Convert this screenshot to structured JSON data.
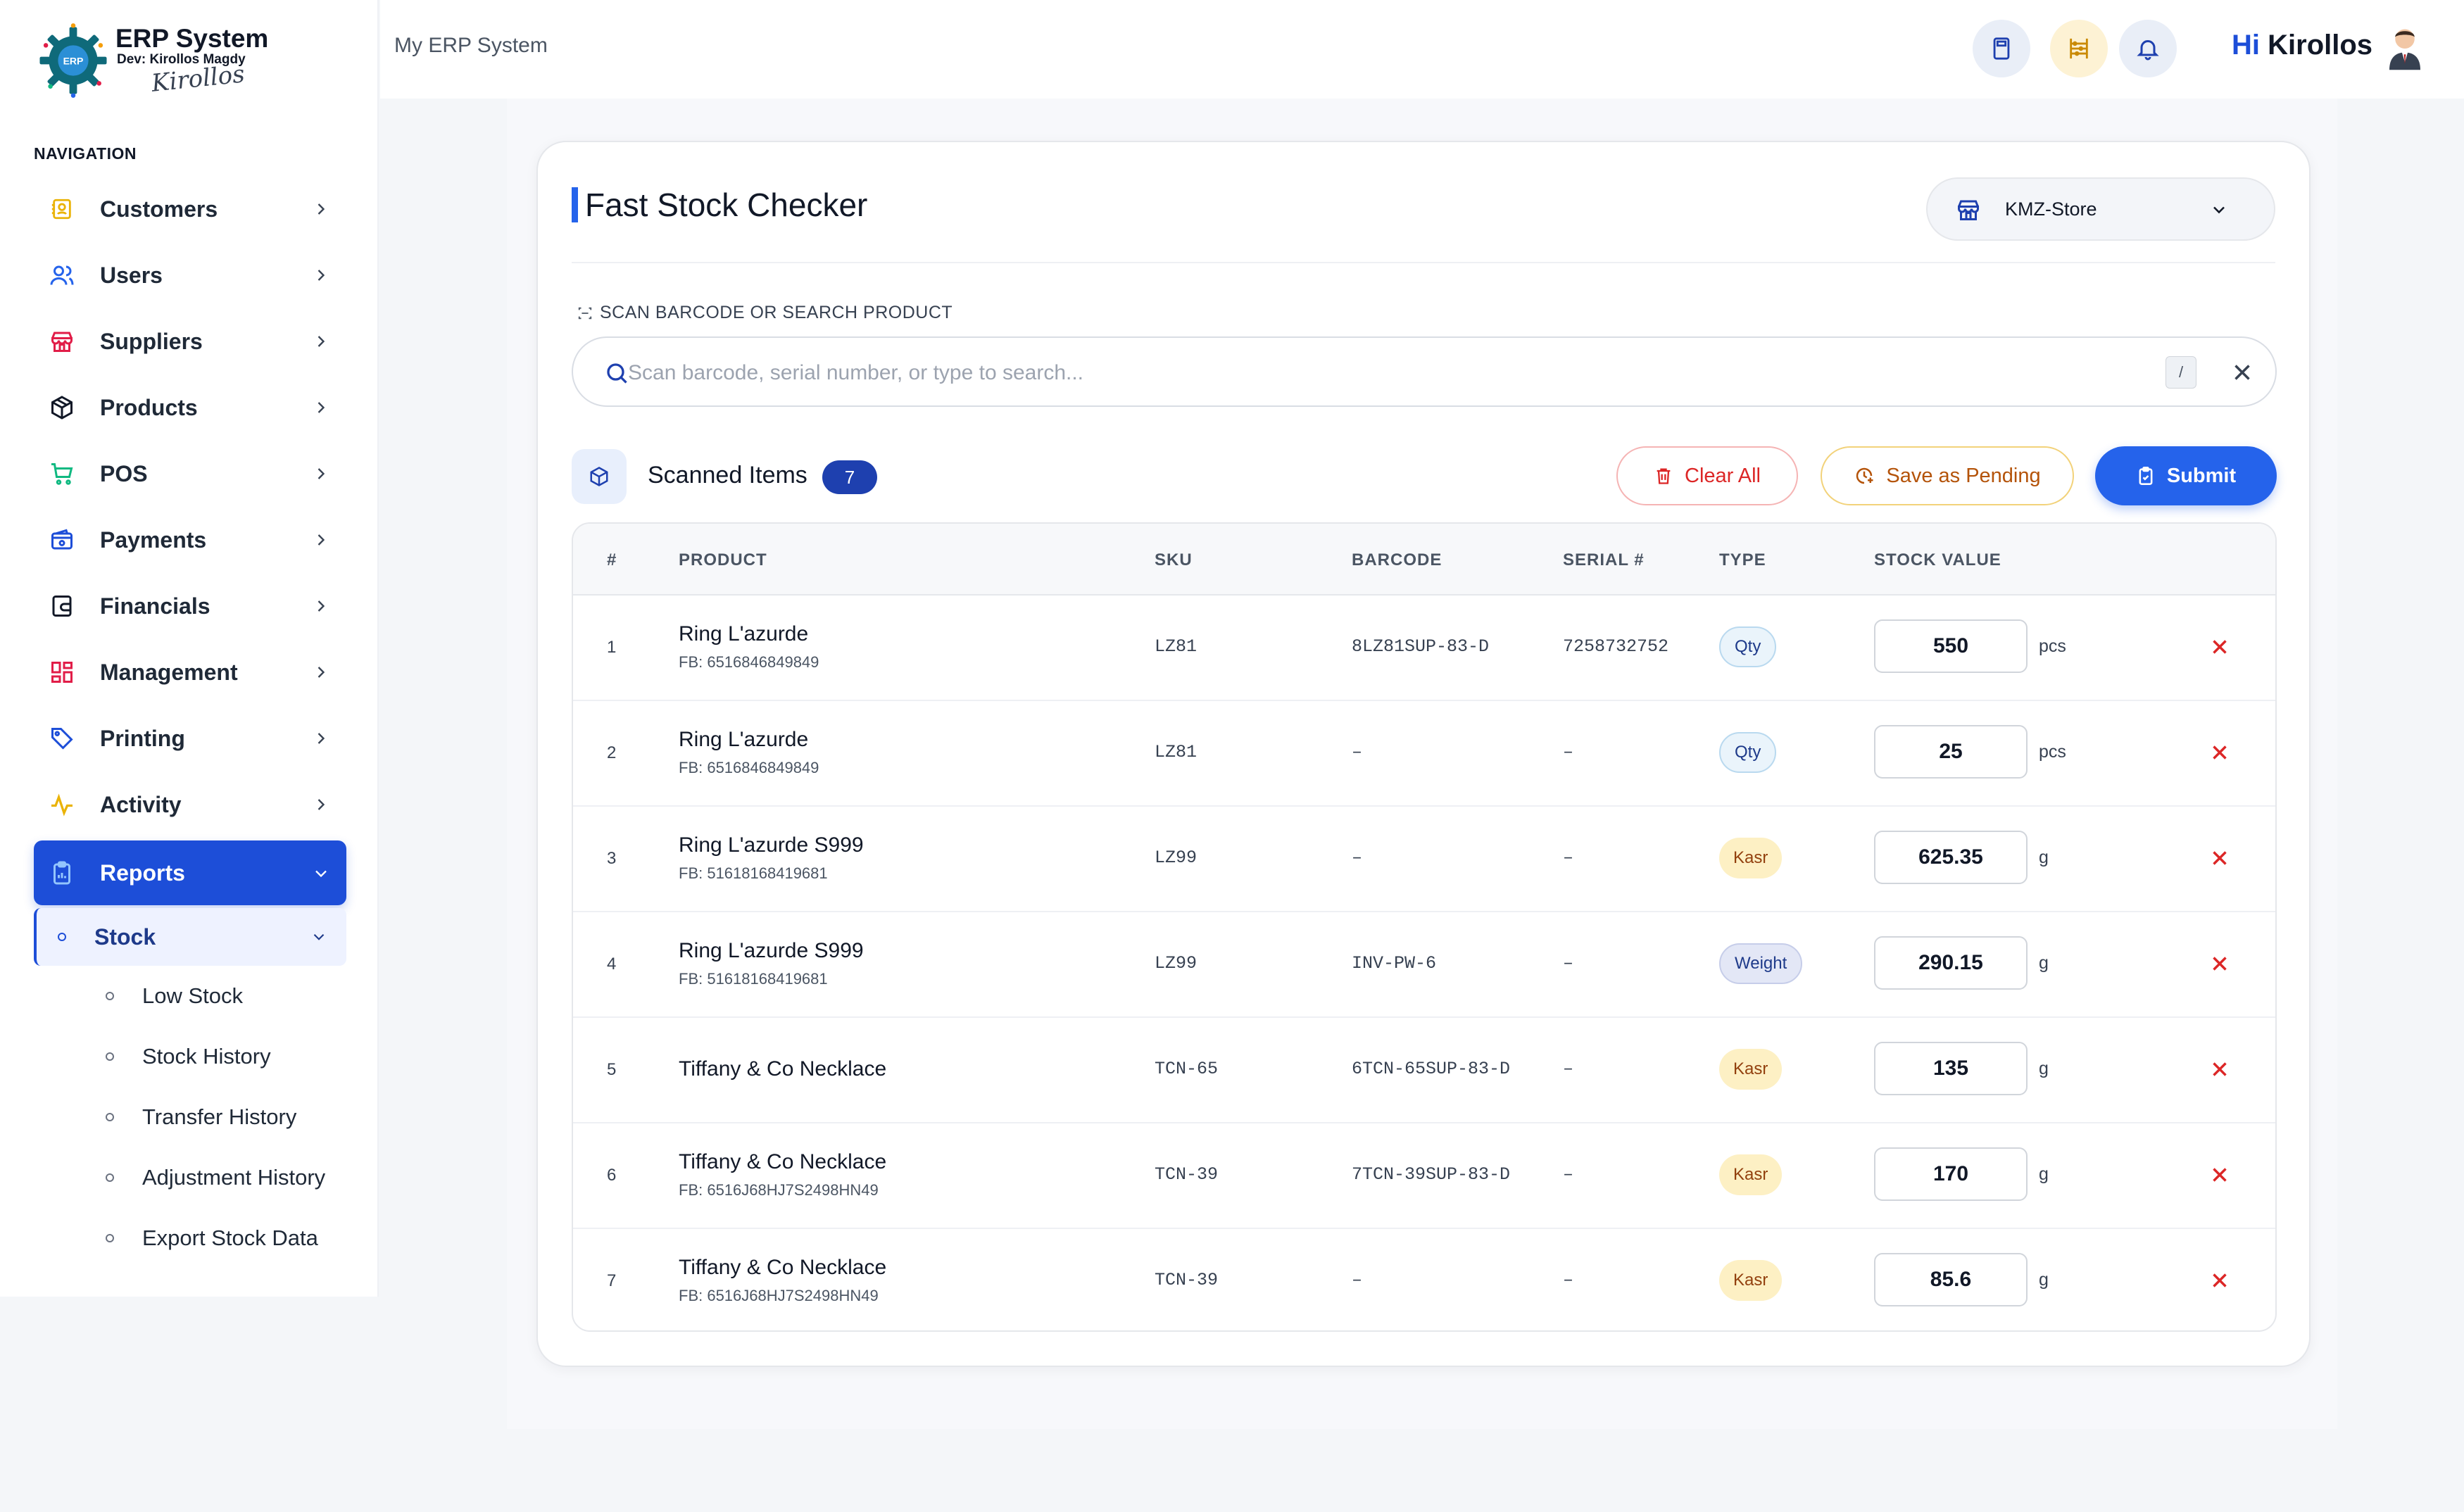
{
  "brand": {
    "title": "ERP System",
    "dev": "Dev: Kirollos Magdy",
    "signature": "Kirollos",
    "logo_text": "ERP"
  },
  "nav": {
    "heading": "NAVIGATION",
    "items": [
      {
        "label": "Customers",
        "icon": "contacts-icon",
        "color": "#eab308"
      },
      {
        "label": "Users",
        "icon": "users-icon",
        "color": "#2563eb"
      },
      {
        "label": "Suppliers",
        "icon": "store-icon",
        "color": "#e11d48"
      },
      {
        "label": "Products",
        "icon": "box-icon",
        "color": "#111827"
      },
      {
        "label": "POS",
        "icon": "cart-icon",
        "color": "#10b981"
      },
      {
        "label": "Payments",
        "icon": "wallet-icon",
        "color": "#1d4ed8"
      },
      {
        "label": "Financials",
        "icon": "ledger-icon",
        "color": "#111827"
      },
      {
        "label": "Management",
        "icon": "grid-icon",
        "color": "#e11d48"
      },
      {
        "label": "Printing",
        "icon": "tag-icon",
        "color": "#1d4ed8"
      },
      {
        "label": "Activity",
        "icon": "pulse-icon",
        "color": "#eab308"
      }
    ],
    "active": {
      "label": "Reports",
      "icon": "clipboard-icon"
    },
    "sub_parent": {
      "label": "Stock"
    },
    "sub_items": [
      {
        "label": "Low Stock"
      },
      {
        "label": "Stock History"
      },
      {
        "label": "Transfer History"
      },
      {
        "label": "Adjustment History"
      },
      {
        "label": "Export Stock Data"
      }
    ]
  },
  "topbar": {
    "breadcrumb": "My ERP System",
    "greeting_hi": "Hi",
    "greeting_name": "Kirollos",
    "icons": [
      "calculator-icon",
      "abacus-icon",
      "bell-icon"
    ]
  },
  "page": {
    "title": "Fast Stock Checker",
    "store": "KMZ-Store",
    "scan_label": "SCAN BARCODE OR SEARCH PRODUCT",
    "search_placeholder": "Scan barcode, serial number, or type to search...",
    "search_shortcut": "/",
    "scanned_title": "Scanned Items",
    "scanned_count": "7",
    "buttons": {
      "clear": "Clear All",
      "pending": "Save as Pending",
      "submit": "Submit"
    }
  },
  "table": {
    "headers": [
      "#",
      "PRODUCT",
      "SKU",
      "BARCODE",
      "SERIAL #",
      "TYPE",
      "STOCK VALUE"
    ],
    "rows": [
      {
        "num": "1",
        "product": "Ring L'azurde",
        "fb": "FB: 6516846849849",
        "sku": "LZ81",
        "barcode": "8LZ81SUP-83-D",
        "serial": "7258732752",
        "type": "Qty",
        "value": "550",
        "unit": "pcs"
      },
      {
        "num": "2",
        "product": "Ring L'azurde",
        "fb": "FB: 6516846849849",
        "sku": "LZ81",
        "barcode": "–",
        "serial": "–",
        "type": "Qty",
        "value": "25",
        "unit": "pcs"
      },
      {
        "num": "3",
        "product": "Ring L'azurde S999",
        "fb": "FB: 51618168419681",
        "sku": "LZ99",
        "barcode": "–",
        "serial": "–",
        "type": "Kasr",
        "value": "625.35",
        "unit": "g"
      },
      {
        "num": "4",
        "product": "Ring L'azurde S999",
        "fb": "FB: 51618168419681",
        "sku": "LZ99",
        "barcode": "INV-PW-6",
        "serial": "–",
        "type": "Weight",
        "value": "290.15",
        "unit": "g"
      },
      {
        "num": "5",
        "product": "Tiffany & Co Necklace",
        "fb": "",
        "sku": "TCN-65",
        "barcode": "6TCN-65SUP-83-D",
        "serial": "–",
        "type": "Kasr",
        "value": "135",
        "unit": "g"
      },
      {
        "num": "6",
        "product": "Tiffany & Co Necklace",
        "fb": "FB: 6516J68HJ7S2498HN49",
        "sku": "TCN-39",
        "barcode": "7TCN-39SUP-83-D",
        "serial": "–",
        "type": "Kasr",
        "value": "170",
        "unit": "g"
      },
      {
        "num": "7",
        "product": "Tiffany & Co Necklace",
        "fb": "FB: 6516J68HJ7S2498HN49",
        "sku": "TCN-39",
        "barcode": "–",
        "serial": "–",
        "type": "Kasr",
        "value": "85.6",
        "unit": "g"
      }
    ]
  },
  "colors": {
    "accent": "#2563eb",
    "active_nav": "#1d4ed8",
    "danger": "#dc2626",
    "warning": "#b45309"
  }
}
